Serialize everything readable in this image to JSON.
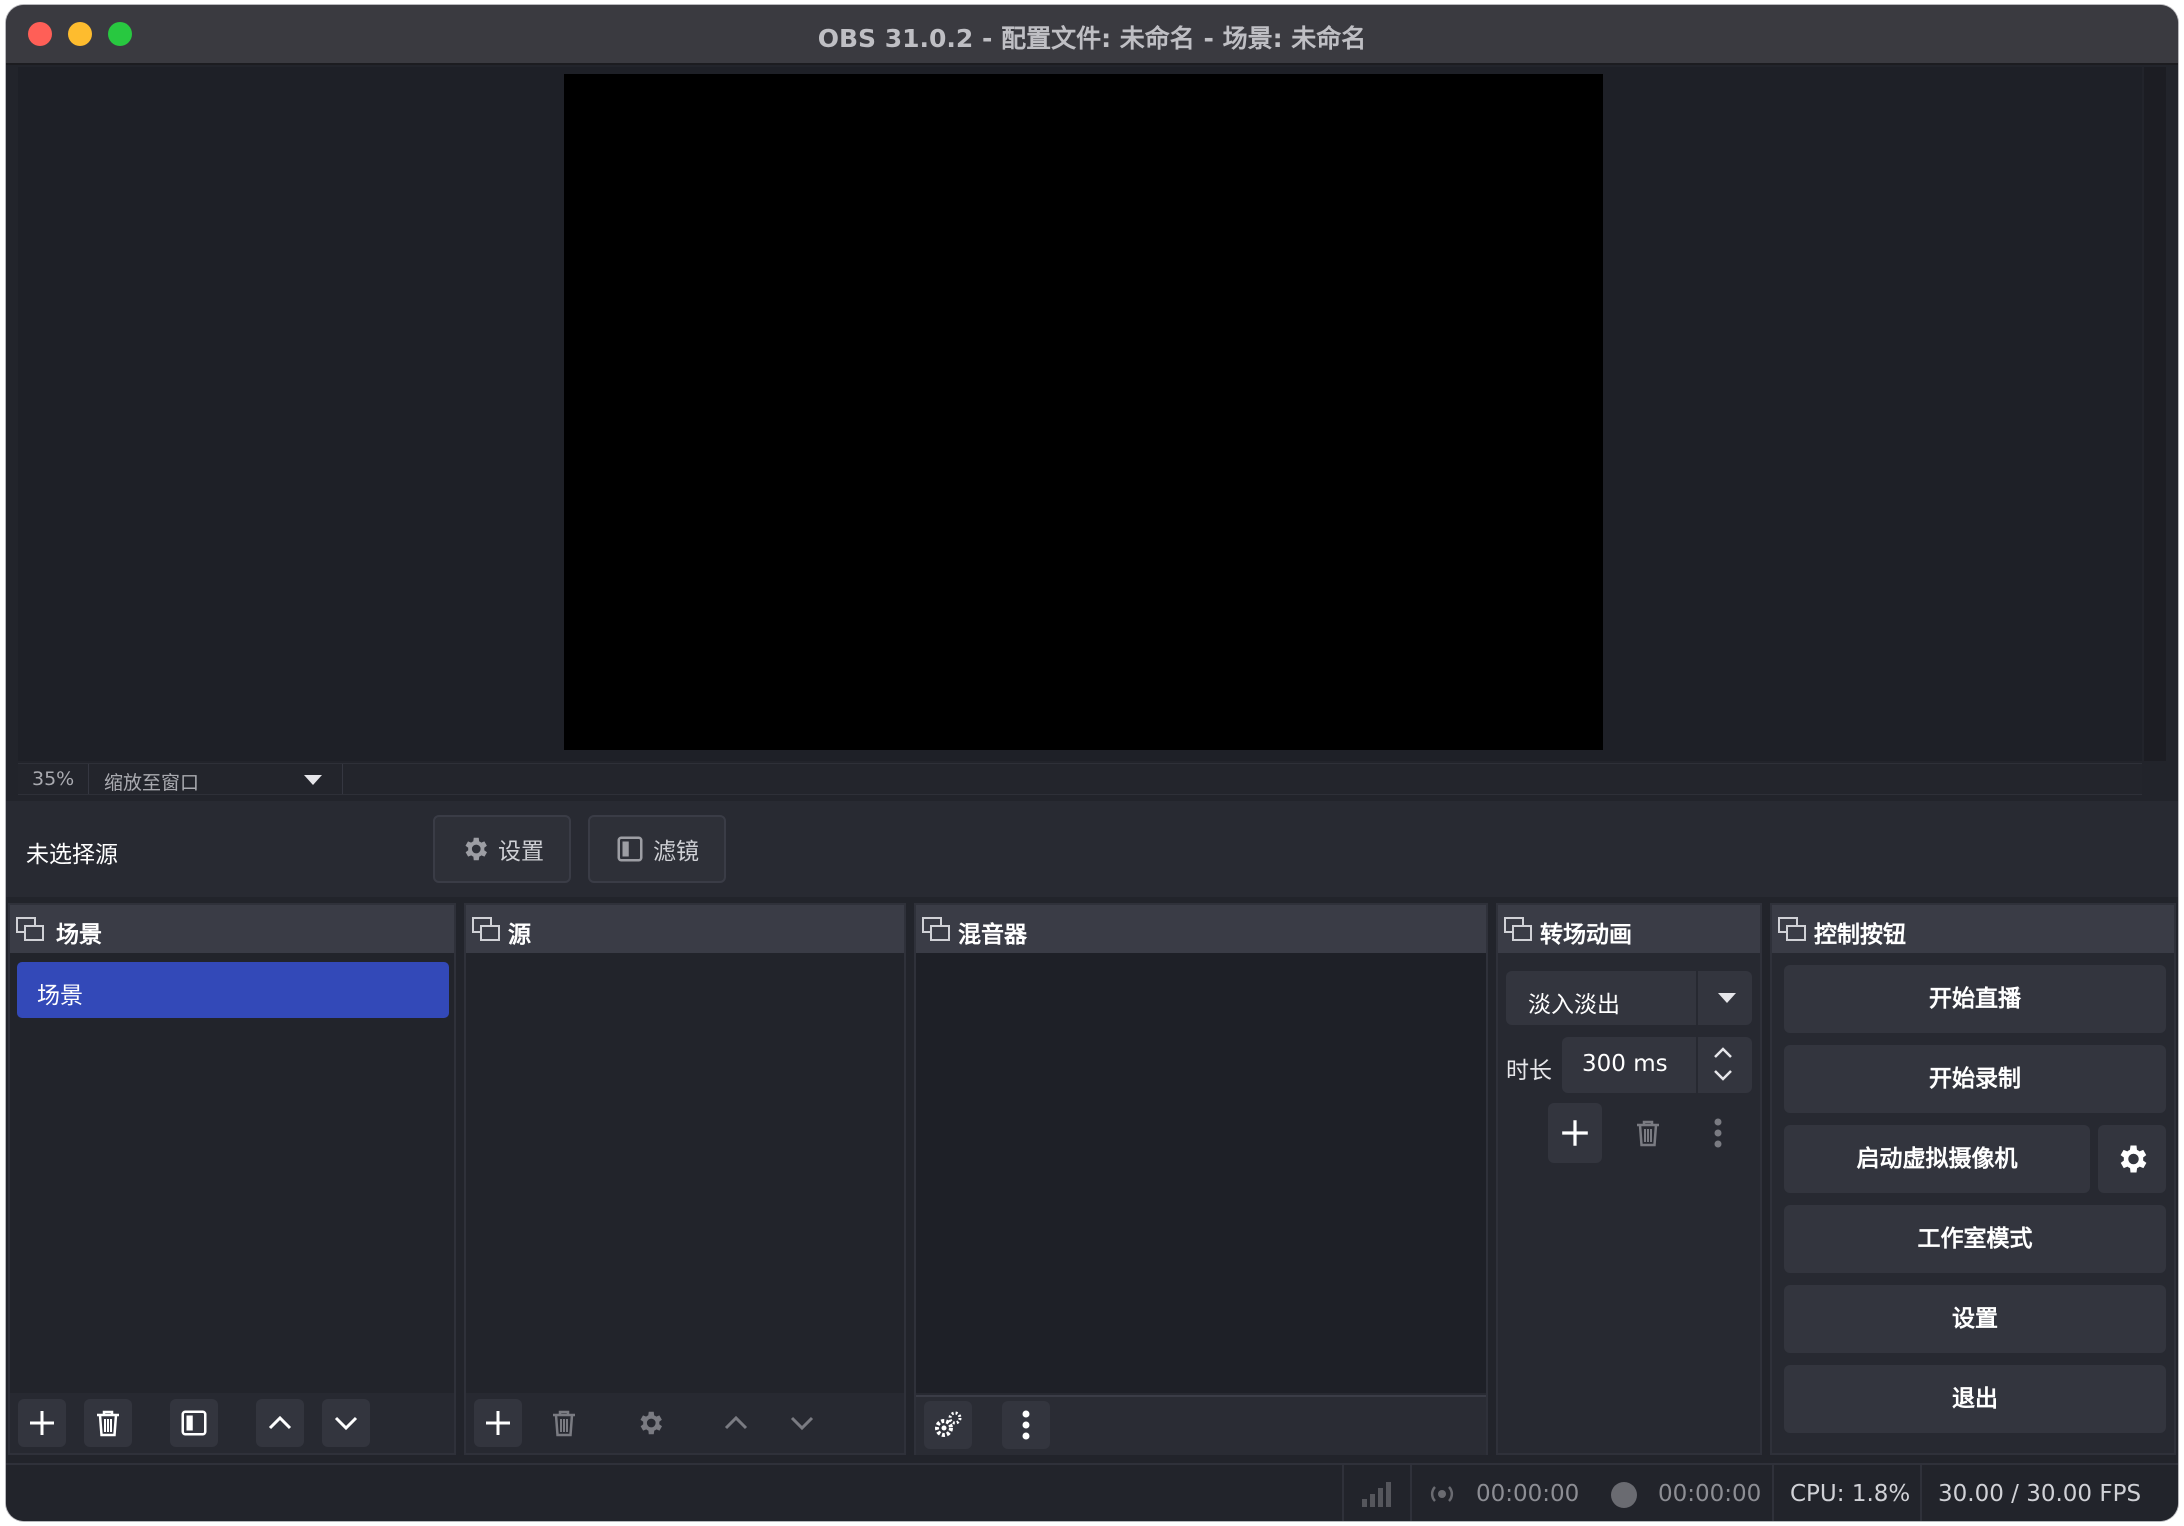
{
  "window": {
    "title": "OBS 31.0.2 - 配置文件: 未命名 - 场景: 未命名"
  },
  "preview": {
    "zoom_percent": "35%",
    "zoom_mode": "缩放至窗口"
  },
  "source_bar": {
    "status": "未选择源",
    "settings_label": "设置",
    "filters_label": "滤镜"
  },
  "docks": {
    "scenes": {
      "title": "场景",
      "items": [
        "场景"
      ],
      "selected_index": 0
    },
    "sources": {
      "title": "源"
    },
    "mixer": {
      "title": "混音器"
    },
    "transitions": {
      "title": "转场动画",
      "selected": "淡入淡出",
      "duration_label": "时长",
      "duration_value": "300 ms"
    },
    "controls": {
      "title": "控制按钮",
      "start_streaming": "开始直播",
      "start_recording": "开始录制",
      "start_virtual_camera": "启动虚拟摄像机",
      "studio_mode": "工作室模式",
      "settings": "设置",
      "exit": "退出"
    }
  },
  "status": {
    "stream_time": "00:00:00",
    "record_time": "00:00:00",
    "cpu": "CPU: 1.8%",
    "fps": "30.00 / 30.00 FPS"
  },
  "colors": {
    "accent": "#3349b8",
    "background": "#22242b",
    "header": "#3a3c46"
  }
}
